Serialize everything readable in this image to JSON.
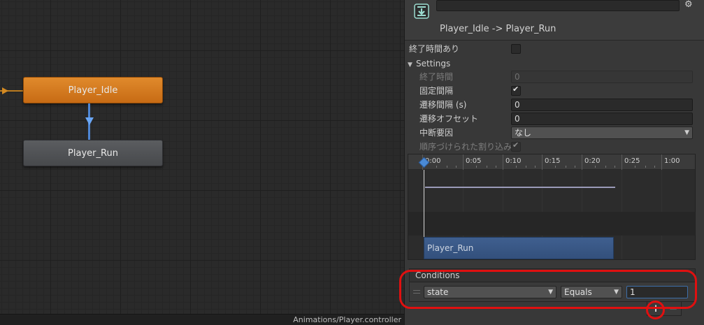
{
  "graph": {
    "states": [
      {
        "name": "Player_Idle"
      },
      {
        "name": "Player_Run"
      }
    ],
    "status_path": "Animations/Player.controller"
  },
  "inspector": {
    "name_field": "",
    "transition_title": "Player_Idle -> Player_Run",
    "has_exit_time": {
      "label": "終了時間あり",
      "checked": false
    },
    "settings_label": "Settings",
    "exit_time": {
      "label": "終了時間",
      "value": "0"
    },
    "fixed_duration": {
      "label": "固定間隔",
      "checked": true
    },
    "transition_duration": {
      "label": "遷移間隔 (s)",
      "value": "0"
    },
    "transition_offset": {
      "label": "遷移オフセット",
      "value": "0"
    },
    "interruption_source": {
      "label": "中断要因",
      "value": "なし"
    },
    "ordered_interruption": {
      "label": "順序づけられた割り込み",
      "checked": true
    },
    "timeline": {
      "ticks": [
        "0:00",
        "0:05",
        "0:10",
        "0:15",
        "0:20",
        "0:25",
        "1:00"
      ],
      "destination_clip": "Player_Run"
    },
    "conditions": {
      "header": "Conditions",
      "parameter": "state",
      "mode": "Equals",
      "value": "1",
      "add_label": "+",
      "remove_label": "−"
    }
  },
  "colors": {
    "idle_state": "#d77c22",
    "run_state": "#505255",
    "transition": "#4e86d4",
    "annotation": "#e01010"
  }
}
